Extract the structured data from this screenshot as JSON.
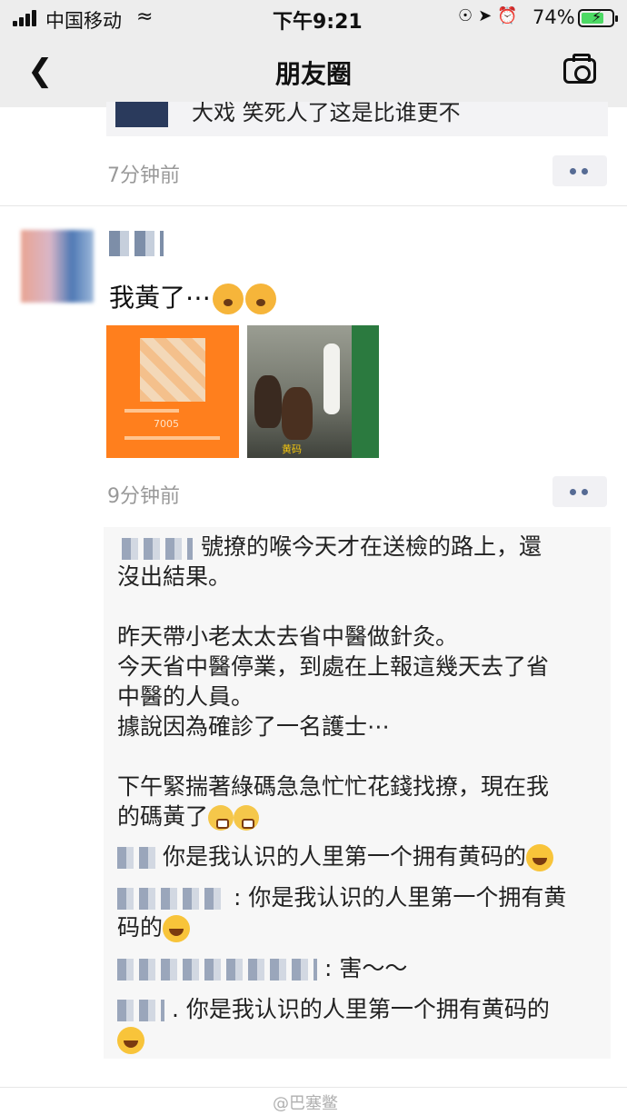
{
  "status_bar": {
    "carrier": "中国移动",
    "time": "下午9:21",
    "battery": "74%",
    "battery_level": 0.74
  },
  "nav": {
    "title": "朋友圈"
  },
  "prev_post": {
    "link_text": "大戏 笑死人了这是比谁更不",
    "time": "7分钟前"
  },
  "post": {
    "text": "我黃了⋯",
    "time": "9分钟前",
    "photo1_caption": "7005",
    "photo2_caption": "黄码"
  },
  "comments": {
    "main": "號撩的喉今天才在送檢的路上，還\n沒出結果。\n\n昨天帶小老太太去省中醫做針灸。\n今天省中醫停業，到處在上報這幾天去了省\n中醫的人員。\n據說因為確診了一名護士⋯\n\n下午緊揣著綠碼急急忙忙花錢找撩，現在我\n的碼黃了",
    "reply1": "你是我认识的人里第一个拥有黄码的",
    "reply2": ": 你是我认识的人里第一个拥有黄",
    "reply2_cont": "码的",
    "reply3": ": 害～～",
    "reply4": ". 你是我认识的人里第一个拥有黄码的"
  },
  "watermark": "@巴塞鳖"
}
